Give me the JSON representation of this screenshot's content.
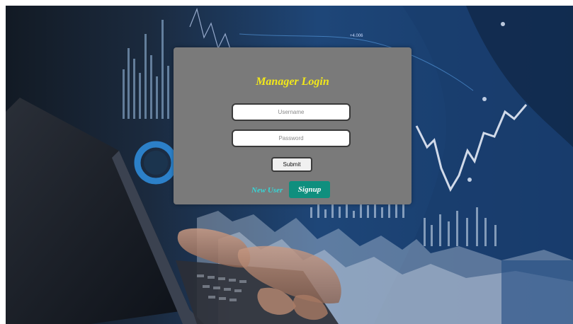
{
  "login": {
    "title": "Manager Login",
    "username_placeholder": "Username",
    "password_placeholder": "Password",
    "submit_label": "Submit",
    "new_user_label": "New User",
    "signup_label": "Signup"
  },
  "background": {
    "tick_label": "+4.006"
  },
  "colors": {
    "card": "#7a7a7a",
    "title": "#f2e81a",
    "new_user": "#36d6d6",
    "signup": "#0f8f7e",
    "background": "#0d1a2e"
  }
}
